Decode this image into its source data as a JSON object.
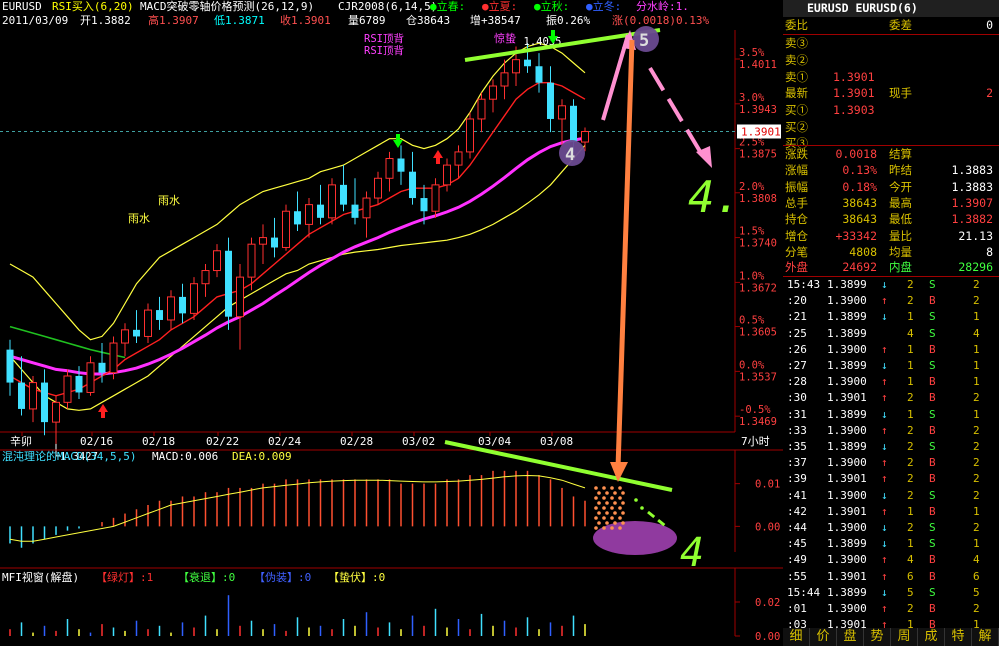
{
  "header": {
    "symbol": "EURUSD",
    "ind1": "RSI买入(6,20)",
    "ind2": "MACD突破零轴价格预测(26,12,9)",
    "ind3": "CJR2008(6,14,5)",
    "leg1": "●立春:",
    "leg2": "●立夏:",
    "leg3": "●立秋:",
    "leg4": "●立冬:",
    "leg5": "分水岭:1.",
    "line2_date": "2011/03/09",
    "line2_open": "开1.3882",
    "line2_high": "高1.3907",
    "line2_low": "低1.3871",
    "line2_close": "收1.3901",
    "line2_vol": "量6789",
    "line2_oi": "仓38643",
    "line2_inc": "增+38547",
    "line2_amp": "振0.26%",
    "line2_chg": "涨(0.0018)0.13%"
  },
  "chart_data": [
    {
      "type": "candlestick",
      "title": "",
      "x_labels": [
        "辛卯",
        "02/16",
        "02/18",
        "02/22",
        "02/24",
        "02/28",
        "03/02",
        "03/04",
        "03/08"
      ],
      "period_label": "7小时",
      "y_right_prices": [
        "1.4011",
        "1.3943",
        "1.3875",
        "1.3808",
        "1.3740",
        "1.3672",
        "1.3605",
        "1.3537",
        "1.3469"
      ],
      "y_right_pct": [
        "3.5%",
        "3.0%",
        "2.5%",
        "2.0%",
        "1.5%",
        "1.0%",
        "0.5%",
        "0.0%",
        "-0.5%"
      ],
      "current_price": "1.3901",
      "high_label": "1.4035",
      "low_label": "1.3427",
      "ylim": [
        1.3445,
        1.4055
      ],
      "candles": [
        [
          1.357,
          1.3585,
          1.35,
          1.352
        ],
        [
          1.352,
          1.356,
          1.347,
          1.348
        ],
        [
          1.348,
          1.353,
          1.346,
          1.352
        ],
        [
          1.352,
          1.354,
          1.344,
          1.346
        ],
        [
          1.346,
          1.35,
          1.3427,
          1.349
        ],
        [
          1.349,
          1.354,
          1.348,
          1.353
        ],
        [
          1.353,
          1.3545,
          1.3495,
          1.3505
        ],
        [
          1.3505,
          1.356,
          1.35,
          1.355
        ],
        [
          1.355,
          1.358,
          1.352,
          1.3535
        ],
        [
          1.3535,
          1.359,
          1.3525,
          1.358
        ],
        [
          1.358,
          1.361,
          1.356,
          1.36
        ],
        [
          1.36,
          1.363,
          1.358,
          1.359
        ],
        [
          1.359,
          1.364,
          1.358,
          1.363
        ],
        [
          1.363,
          1.365,
          1.36,
          1.3615
        ],
        [
          1.3615,
          1.366,
          1.36,
          1.365
        ],
        [
          1.365,
          1.367,
          1.361,
          1.3625
        ],
        [
          1.3625,
          1.368,
          1.3615,
          1.367
        ],
        [
          1.367,
          1.37,
          1.365,
          1.369
        ],
        [
          1.369,
          1.373,
          1.368,
          1.372
        ],
        [
          1.372,
          1.374,
          1.36,
          1.362
        ],
        [
          1.362,
          1.37,
          1.357,
          1.368
        ],
        [
          1.368,
          1.374,
          1.366,
          1.373
        ],
        [
          1.373,
          1.376,
          1.37,
          1.374
        ],
        [
          1.374,
          1.377,
          1.371,
          1.3725
        ],
        [
          1.3725,
          1.379,
          1.372,
          1.378
        ],
        [
          1.378,
          1.381,
          1.375,
          1.376
        ],
        [
          1.376,
          1.38,
          1.374,
          1.379
        ],
        [
          1.379,
          1.382,
          1.376,
          1.377
        ],
        [
          1.377,
          1.383,
          1.376,
          1.382
        ],
        [
          1.382,
          1.385,
          1.378,
          1.379
        ],
        [
          1.379,
          1.383,
          1.376,
          1.377
        ],
        [
          1.377,
          1.381,
          1.374,
          1.38
        ],
        [
          1.38,
          1.384,
          1.379,
          1.383
        ],
        [
          1.383,
          1.387,
          1.381,
          1.386
        ],
        [
          1.386,
          1.388,
          1.382,
          1.384
        ],
        [
          1.384,
          1.387,
          1.379,
          1.38
        ],
        [
          1.38,
          1.382,
          1.376,
          1.378
        ],
        [
          1.378,
          1.383,
          1.377,
          1.382
        ],
        [
          1.382,
          1.386,
          1.381,
          1.385
        ],
        [
          1.385,
          1.388,
          1.383,
          1.387
        ],
        [
          1.387,
          1.393,
          1.386,
          1.392
        ],
        [
          1.392,
          1.396,
          1.39,
          1.395
        ],
        [
          1.395,
          1.398,
          1.393,
          1.397
        ],
        [
          1.397,
          1.401,
          1.395,
          1.399
        ],
        [
          1.399,
          1.403,
          1.397,
          1.401
        ],
        [
          1.401,
          1.4035,
          1.399,
          1.4
        ],
        [
          1.4,
          1.402,
          1.396,
          1.3975
        ],
        [
          1.3975,
          1.4,
          1.39,
          1.392
        ],
        [
          1.392,
          1.395,
          1.388,
          1.394
        ],
        [
          1.394,
          1.395,
          1.387,
          1.3885
        ],
        [
          1.3885,
          1.3907,
          1.3871,
          1.3901
        ]
      ],
      "ma_red": [
        1.353,
        1.352,
        1.351,
        1.3505,
        1.35,
        1.3505,
        1.351,
        1.352,
        1.353,
        1.354,
        1.3555,
        1.3565,
        1.3575,
        1.3585,
        1.36,
        1.361,
        1.362,
        1.3635,
        1.365,
        1.3655,
        1.366,
        1.367,
        1.3685,
        1.37,
        1.3715,
        1.373,
        1.3745,
        1.3755,
        1.3765,
        1.3775,
        1.378,
        1.3785,
        1.379,
        1.38,
        1.381,
        1.3815,
        1.3815,
        1.3815,
        1.382,
        1.383,
        1.385,
        1.3875,
        1.39,
        1.3925,
        1.395,
        1.3965,
        1.3975,
        1.3975,
        1.397,
        1.396,
        1.395
      ],
      "ma_magenta": [
        1.356,
        1.3555,
        1.355,
        1.3545,
        1.354,
        1.3538,
        1.3535,
        1.3533,
        1.3533,
        1.3535,
        1.3538,
        1.3542,
        1.3548,
        1.3555,
        1.3563,
        1.3572,
        1.3582,
        1.3592,
        1.3603,
        1.3612,
        1.362,
        1.363,
        1.364,
        1.3652,
        1.3663,
        1.3675,
        1.3687,
        1.3698,
        1.3708,
        1.3718,
        1.3726,
        1.3733,
        1.374,
        1.3748,
        1.3755,
        1.3762,
        1.3768,
        1.3773,
        1.3779,
        1.3786,
        1.3795,
        1.3806,
        1.3818,
        1.3831,
        1.3845,
        1.3858,
        1.3869,
        1.3878,
        1.3884,
        1.3888,
        1.3891
      ],
      "band_upper": [
        1.37,
        1.369,
        1.368,
        1.366,
        1.364,
        1.362,
        1.36,
        1.3585,
        1.359,
        1.361,
        1.364,
        1.367,
        1.369,
        1.371,
        1.372,
        1.373,
        1.374,
        1.375,
        1.376,
        1.3775,
        1.379,
        1.38,
        1.381,
        1.3815,
        1.382,
        1.3825,
        1.383,
        1.384,
        1.3845,
        1.385,
        1.386,
        1.387,
        1.388,
        1.389,
        1.389,
        1.388,
        1.3875,
        1.388,
        1.389,
        1.3905,
        1.393,
        1.396,
        1.3985,
        1.4005,
        1.402,
        1.403,
        1.4035,
        1.403,
        1.402,
        1.4005,
        1.399
      ],
      "band_lower": [
        1.356,
        1.354,
        1.352,
        1.35,
        1.349,
        1.348,
        1.3478,
        1.348,
        1.349,
        1.35,
        1.351,
        1.352,
        1.353,
        1.3545,
        1.356,
        1.3575,
        1.359,
        1.3605,
        1.362,
        1.3635,
        1.3645,
        1.3655,
        1.3665,
        1.3675,
        1.3685,
        1.369,
        1.37,
        1.3705,
        1.371,
        1.3715,
        1.3718,
        1.372,
        1.3722,
        1.3725,
        1.3728,
        1.373,
        1.3732,
        1.3734,
        1.3736,
        1.374,
        1.3745,
        1.3752,
        1.376,
        1.377,
        1.378,
        1.3792,
        1.3805,
        1.382,
        1.384,
        1.386,
        1.388
      ],
      "ma_green": [
        1.3605,
        1.36,
        1.3595,
        1.359,
        1.3585,
        1.358,
        1.3575,
        1.357,
        1.3566,
        1.3562,
        1.3558
      ]
    },
    {
      "type": "bar",
      "title": "混沌理论的MACD(34,5,5)",
      "macd_label": "MACD:0.006",
      "dea_label": "DEA:0.009",
      "y_ticks": [
        "0.01",
        "0.00"
      ],
      "ylim": [
        -0.006,
        0.016
      ],
      "macd": [
        -0.004,
        -0.005,
        -0.004,
        -0.003,
        -0.002,
        -0.001,
        -0.0005,
        0.0,
        0.001,
        0.002,
        0.003,
        0.004,
        0.005,
        0.006,
        0.006,
        0.007,
        0.007,
        0.008,
        0.008,
        0.009,
        0.009,
        0.009,
        0.01,
        0.01,
        0.011,
        0.011,
        0.011,
        0.011,
        0.011,
        0.011,
        0.011,
        0.011,
        0.011,
        0.011,
        0.01,
        0.01,
        0.01,
        0.01,
        0.011,
        0.011,
        0.012,
        0.012,
        0.013,
        0.013,
        0.013,
        0.013,
        0.012,
        0.011,
        0.009,
        0.007,
        0.006
      ],
      "dea": [
        -0.003,
        -0.0035,
        -0.0035,
        -0.003,
        -0.0025,
        -0.002,
        -0.0015,
        -0.001,
        -0.0005,
        0.0,
        0.001,
        0.002,
        0.003,
        0.004,
        0.005,
        0.0055,
        0.006,
        0.0065,
        0.007,
        0.0075,
        0.008,
        0.0085,
        0.009,
        0.0093,
        0.0096,
        0.0099,
        0.0102,
        0.0104,
        0.0106,
        0.0107,
        0.0108,
        0.0108,
        0.0108,
        0.0107,
        0.0106,
        0.0105,
        0.0104,
        0.0104,
        0.0105,
        0.0106,
        0.0108,
        0.011,
        0.0113,
        0.0116,
        0.0118,
        0.0119,
        0.0118,
        0.0114,
        0.0108,
        0.0099,
        0.009
      ]
    },
    {
      "type": "bar",
      "title": "",
      "label_a": "MFI视窗(解盘)",
      "label_b": "【绿灯】:1",
      "label_c": "【衰退】:0",
      "label_d": "【伪装】:0",
      "label_e": "【蛰伏】:0",
      "y_ticks": [
        "0.02",
        "0.00"
      ],
      "ylim": [
        0,
        0.03
      ],
      "values": [
        0.004,
        0.008,
        0.002,
        0.006,
        0.003,
        0.01,
        0.004,
        0.002,
        0.007,
        0.005,
        0.003,
        0.009,
        0.004,
        0.006,
        0.002,
        0.008,
        0.005,
        0.012,
        0.004,
        0.024,
        0.006,
        0.009,
        0.004,
        0.007,
        0.003,
        0.011,
        0.005,
        0.006,
        0.004,
        0.01,
        0.006,
        0.014,
        0.005,
        0.008,
        0.004,
        0.012,
        0.006,
        0.016,
        0.005,
        0.01,
        0.004,
        0.013,
        0.006,
        0.009,
        0.005,
        0.011,
        0.004,
        0.008,
        0.006,
        0.012,
        0.007
      ]
    }
  ],
  "annotations": {
    "yushui": "雨水",
    "rsi1": "RSI顶背",
    "rsi2": "RSI顶背",
    "jingzhe": "惊蛰",
    "n4": "4",
    "n5": "5",
    "green4": "4."
  },
  "panel": {
    "title": "EURUSD  EURUSD(6)",
    "r1": [
      "委比",
      "委差",
      "0"
    ],
    "sell3": "卖③",
    "sell2": "卖②",
    "sell1": [
      "卖①",
      "1.3901"
    ],
    "latest": [
      "最新",
      "1.3901",
      "现手",
      "2"
    ],
    "buy1": [
      "买①",
      "1.3903"
    ],
    "buy2": "买②",
    "buy3": "买③",
    "s1": [
      "涨跌",
      "0.0018",
      "结算",
      ""
    ],
    "s2": [
      "涨幅",
      "0.13%",
      "昨结",
      "1.3883"
    ],
    "s3": [
      "振幅",
      "0.18%",
      "今开",
      "1.3883"
    ],
    "s4": [
      "总手",
      "38643",
      "最高",
      "1.3907"
    ],
    "s5": [
      "持仓",
      "38643",
      "最低",
      "1.3882"
    ],
    "s6": [
      "增仓",
      "+33342",
      "量比",
      "21.13"
    ],
    "s7": [
      "分笔",
      "4808",
      "均量",
      "8"
    ],
    "s8": [
      "外盘",
      "24692",
      "内盘",
      "28296"
    ],
    "ticks": [
      [
        "15:43",
        "1.3899",
        "↓",
        "2",
        "S",
        "2"
      ],
      [
        ":20",
        "1.3900",
        "↑",
        "2",
        "B",
        "2"
      ],
      [
        ":21",
        "1.3899",
        "↓",
        "1",
        "S",
        "1"
      ],
      [
        ":25",
        "1.3899",
        "",
        "4",
        "S",
        "4"
      ],
      [
        ":26",
        "1.3900",
        "↑",
        "1",
        "B",
        "1"
      ],
      [
        ":27",
        "1.3899",
        "↓",
        "1",
        "S",
        "1"
      ],
      [
        ":28",
        "1.3900",
        "↑",
        "1",
        "B",
        "1"
      ],
      [
        ":30",
        "1.3901",
        "↑",
        "2",
        "B",
        "2"
      ],
      [
        ":31",
        "1.3899",
        "↓",
        "1",
        "S",
        "1"
      ],
      [
        ":33",
        "1.3900",
        "↑",
        "2",
        "B",
        "2"
      ],
      [
        ":35",
        "1.3899",
        "↓",
        "2",
        "S",
        "2"
      ],
      [
        ":37",
        "1.3900",
        "↑",
        "2",
        "B",
        "2"
      ],
      [
        ":39",
        "1.3901",
        "↑",
        "2",
        "B",
        "2"
      ],
      [
        ":41",
        "1.3900",
        "↓",
        "2",
        "S",
        "2"
      ],
      [
        ":42",
        "1.3901",
        "↑",
        "1",
        "B",
        "1"
      ],
      [
        ":44",
        "1.3900",
        "↓",
        "2",
        "S",
        "2"
      ],
      [
        ":45",
        "1.3899",
        "↓",
        "1",
        "S",
        "1"
      ],
      [
        ":49",
        "1.3900",
        "↑",
        "4",
        "B",
        "4"
      ],
      [
        ":55",
        "1.3901",
        "↑",
        "6",
        "B",
        "6"
      ],
      [
        "15:44",
        "1.3899",
        "↓",
        "5",
        "S",
        "5"
      ],
      [
        ":01",
        "1.3900",
        "↑",
        "2",
        "B",
        "2"
      ],
      [
        ":03",
        "1.3901",
        "↑",
        "1",
        "B",
        "1"
      ]
    ],
    "tabs": [
      "细",
      "价",
      "盘",
      "势",
      "周",
      "成",
      "特",
      "解"
    ]
  }
}
